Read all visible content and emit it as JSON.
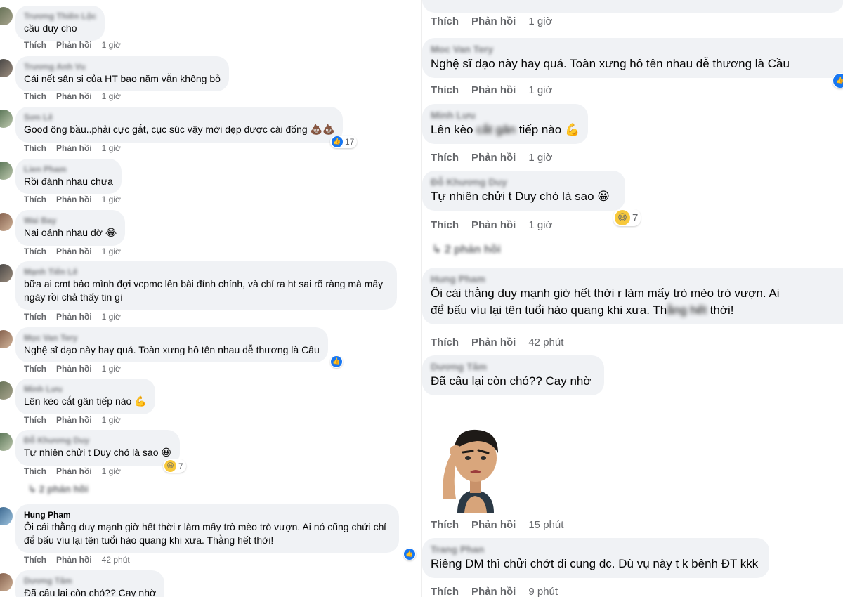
{
  "labels": {
    "like": "Thích",
    "reply": "Phản hồi"
  },
  "left": [
    {
      "name": "Trương Thiên Lộc",
      "text": "cầu duy cho",
      "time": "1 giờ"
    },
    {
      "name": "Trương Anh Vu",
      "text": "Cái nết sân si của HT bao năm vẫn không bỏ",
      "time": "1 giờ"
    },
    {
      "name": "Sơn Lê",
      "text": "Good ông bầu..phải cực gắt, cục súc vậy mới dẹp được cái đống",
      "emoji": "💩💩",
      "reaction_count": "17",
      "time": "1 giờ"
    },
    {
      "name": "Lien Pham",
      "text": "Rồi đánh nhau chưa",
      "time": "1 giờ"
    },
    {
      "name": "Wai Bay",
      "text": "Nại oánh nhau dờ",
      "emoji": "😂",
      "time": "1 giờ"
    },
    {
      "name": "Mạnh Tiến Lê",
      "text": "bữa ai cmt bảo mình đợi vcpmc lên bài đính chính, và chỉ ra ht sai rõ ràng mà mấy",
      "text2": "ngày rồi chả thấy tin gì",
      "time": "1 giờ"
    },
    {
      "name": "Mọc Van Tery",
      "text": "Nghệ sĩ dạo này hay quá. Toàn xưng hô tên nhau dễ thương là Cầu",
      "time": "1 giờ"
    },
    {
      "name": "Minh Lưu",
      "text": "Lên kèo cắt gân tiếp nào",
      "emoji": "💪",
      "time": "1 giờ"
    },
    {
      "name": "Đỗ Khương Duy",
      "text": "Tự nhiên chửi t Duy chó là sao",
      "emoji": "😀",
      "reaction_count": "7",
      "time": "1 giờ"
    },
    {
      "name": "Hung Pham",
      "text": "Ôi cái thằng duy mạnh giờ hết thời r làm mấy trò mèo trò vượn. Ai nó cũng chửi chỉ",
      "text2": "để bấu víu lại tên tuổi hào quang khi xưa. Thằng hết thời!",
      "time": "42 phút"
    },
    {
      "name": "Dương Tâm",
      "text": "Đã cầu lại còn chó?? Cay nhờ"
    }
  ],
  "left_replies": "2 phản hồi",
  "right": {
    "top_time": "1 giờ",
    "c1": {
      "name": "Moc Van Tery",
      "text": "Nghệ sĩ dạo này hay quá. Toàn xưng hô tên nhau dễ thương là Cầu",
      "time": "1 giờ"
    },
    "c2": {
      "name": "Minh Lưu",
      "text_a": "Lên kèo",
      "text_b": "cắt gân",
      "text_c": "tiếp nào",
      "emoji": "💪",
      "time": "1 giờ"
    },
    "c3": {
      "name": "Đỗ Khương Duy",
      "text": "Tự nhiên chửi t Duy chó là sao",
      "emoji": "😀",
      "reaction_count": "7",
      "time": "1 giờ"
    },
    "replies": "2 phản hồi",
    "c4": {
      "name": "Hung Pham",
      "text": "Ôi cái thằng duy mạnh giờ hết thời r làm mấy trò mèo trò vượn. Ai",
      "text2a": "để bấu víu lại tên tuổi hào quang khi xưa. Th",
      "text2b": "ằng hết",
      "text2c": " thời!",
      "time": "42 phút"
    },
    "c5": {
      "name": "Dương Tâm",
      "text": "Đã cầu lại còn chó?? Cay nhờ"
    },
    "c6": {
      "time": "15 phút"
    },
    "c7": {
      "name": "Trang Phan",
      "text": "Riêng DM thì chửi chớt đi cung dc. Dù vụ này t k bênh ĐT kkk",
      "time": "9 phút"
    }
  },
  "colors": {
    "bubble": "#f0f2f5",
    "meta": "#65676b",
    "like": "#1877f2"
  }
}
